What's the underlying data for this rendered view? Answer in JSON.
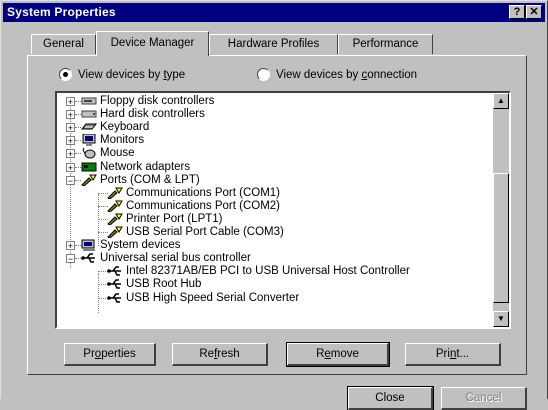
{
  "window": {
    "title": "System Properties",
    "help_glyph": "?",
    "close_glyph": "✕"
  },
  "tabs": [
    {
      "label": "General"
    },
    {
      "label": "Device Manager"
    },
    {
      "label": "Hardware Profiles"
    },
    {
      "label": "Performance"
    }
  ],
  "view_options": {
    "by_type": {
      "label_pre": "View devices by ",
      "label_key": "t",
      "label_post": "ype",
      "selected": true
    },
    "by_connection": {
      "label_pre": "View devices by ",
      "label_key": "c",
      "label_post": "onnection",
      "selected": false
    }
  },
  "tree": [
    {
      "label": "Floppy disk controllers",
      "icon": "floppy-controller-icon",
      "expander": "+"
    },
    {
      "label": "Hard disk controllers",
      "icon": "disk-controller-icon",
      "expander": "+"
    },
    {
      "label": "Keyboard",
      "icon": "keyboard-icon",
      "expander": "+"
    },
    {
      "label": "Monitors",
      "icon": "monitor-icon",
      "expander": "+"
    },
    {
      "label": "Mouse",
      "icon": "mouse-icon",
      "expander": "+"
    },
    {
      "label": "Network adapters",
      "icon": "network-adapter-icon",
      "expander": "+"
    },
    {
      "label": "Ports (COM & LPT)",
      "icon": "port-icon",
      "expander": "−"
    },
    {
      "label": "Communications Port (COM1)",
      "icon": "port-icon"
    },
    {
      "label": "Communications Port (COM2)",
      "icon": "port-icon"
    },
    {
      "label": "Printer Port (LPT1)",
      "icon": "port-icon"
    },
    {
      "label": "USB Serial Port Cable (COM3)",
      "icon": "port-icon"
    },
    {
      "label": "System devices",
      "icon": "system-device-icon",
      "expander": "+"
    },
    {
      "label": "Universal serial bus controller",
      "icon": "usb-icon",
      "expander": "−"
    },
    {
      "label": "Intel 82371AB/EB PCI to USB Universal Host Controller",
      "icon": "usb-icon"
    },
    {
      "label": "USB Root Hub",
      "icon": "usb-icon"
    },
    {
      "label": "USB High Speed Serial Converter",
      "icon": "usb-icon"
    }
  ],
  "buttons": {
    "properties": {
      "pre": "Pr",
      "key": "o",
      "post": "perties"
    },
    "refresh": {
      "pre": "Re",
      "key": "f",
      "post": "resh"
    },
    "remove": {
      "pre": "R",
      "key": "e",
      "post": "move"
    },
    "print": {
      "pre": "Pri",
      "key": "n",
      "post": "t..."
    },
    "close": "Close",
    "cancel": "Cancel"
  },
  "colors": {
    "titlebar": "#000080",
    "face": "#c0c0c0",
    "tree_bg": "#ffffff"
  }
}
